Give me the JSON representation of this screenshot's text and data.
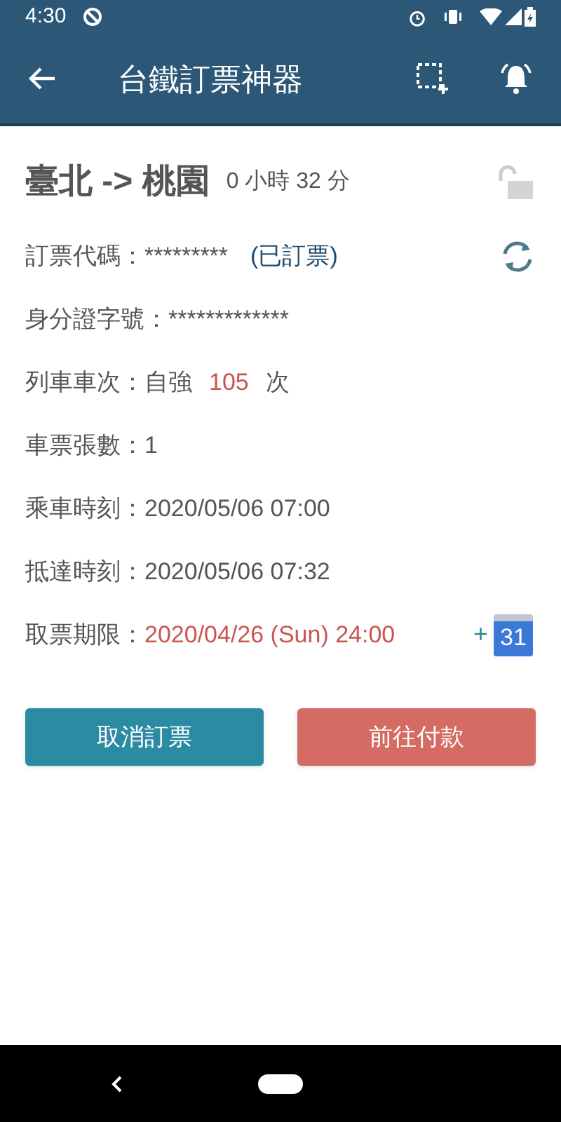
{
  "status_bar": {
    "time": "4:30"
  },
  "app_bar": {
    "title": "台鐵訂票神器"
  },
  "trip": {
    "route": "臺北 -> 桃園",
    "duration": "0 小時 32 分",
    "locked": false
  },
  "rows": [
    {
      "kind": "booking",
      "label": "訂票代碼：",
      "value": "*********",
      "status": "(已訂票)"
    },
    {
      "kind": "plain",
      "label": "身分證字號：",
      "value": "*************"
    },
    {
      "kind": "train",
      "label": "列車車次：",
      "train_type": "自強",
      "train_no": "105",
      "suffix": "次"
    },
    {
      "kind": "plain",
      "label": "車票張數：",
      "value": "1"
    },
    {
      "kind": "plain",
      "label": "乘車時刻：",
      "value": "2020/05/06 07:00"
    },
    {
      "kind": "plain",
      "label": "抵達時刻：",
      "value": "2020/05/06 07:32"
    },
    {
      "kind": "deadline",
      "label": "取票期限：",
      "value": "2020/04/26 (Sun) 24:00",
      "calendar_plus": "+",
      "calendar_day": "31"
    }
  ],
  "buttons": [
    {
      "kind": "cancel",
      "label": "取消訂票"
    },
    {
      "kind": "pay",
      "label": "前往付款"
    }
  ]
}
